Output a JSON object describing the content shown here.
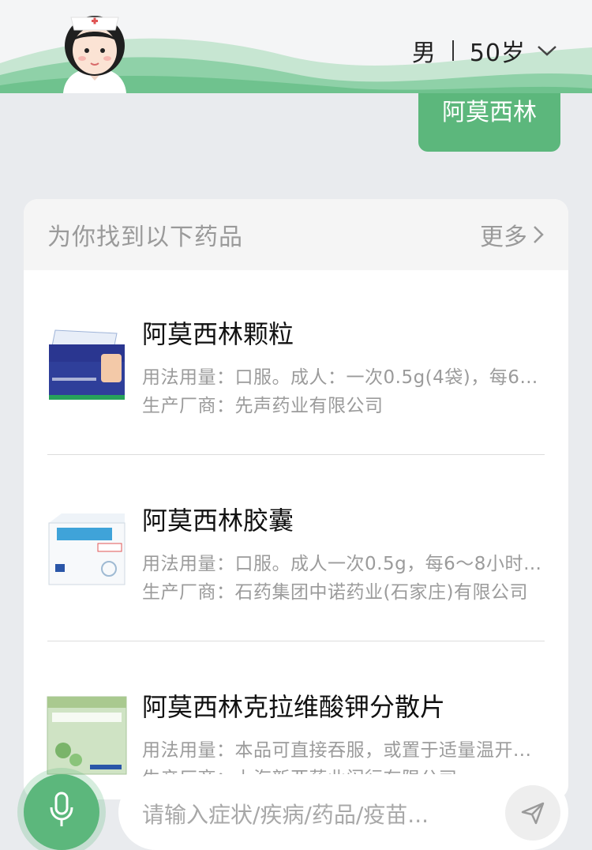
{
  "header": {
    "gender": "男",
    "age": "50岁"
  },
  "chat": {
    "user_message": "阿莫西林"
  },
  "results": {
    "title": "为你找到以下药品",
    "more_label": "更多",
    "items": [
      {
        "name": "阿莫西林颗粒",
        "usage": "用法用量：口服。成人：一次0.5g(4袋)，每6～...",
        "maker": "生产厂商：先声药业有限公司"
      },
      {
        "name": "阿莫西林胶囊",
        "usage": "用法用量：口服。成人一次0.5g，每6～8小时1...",
        "maker": "生产厂商：石药集团中诺药业(石家庄)有限公司"
      },
      {
        "name": "阿莫西林克拉维酸钾分散片",
        "usage": "用法用量：本品可直接吞服，或置于适量温开...",
        "maker": "生产厂商：上海新亚药业闵行有限公司"
      }
    ]
  },
  "input": {
    "placeholder": "请输入症状/疾病/药品/疫苗..."
  },
  "colors": {
    "accent": "#5cb77c",
    "background": "#e9ebee"
  }
}
